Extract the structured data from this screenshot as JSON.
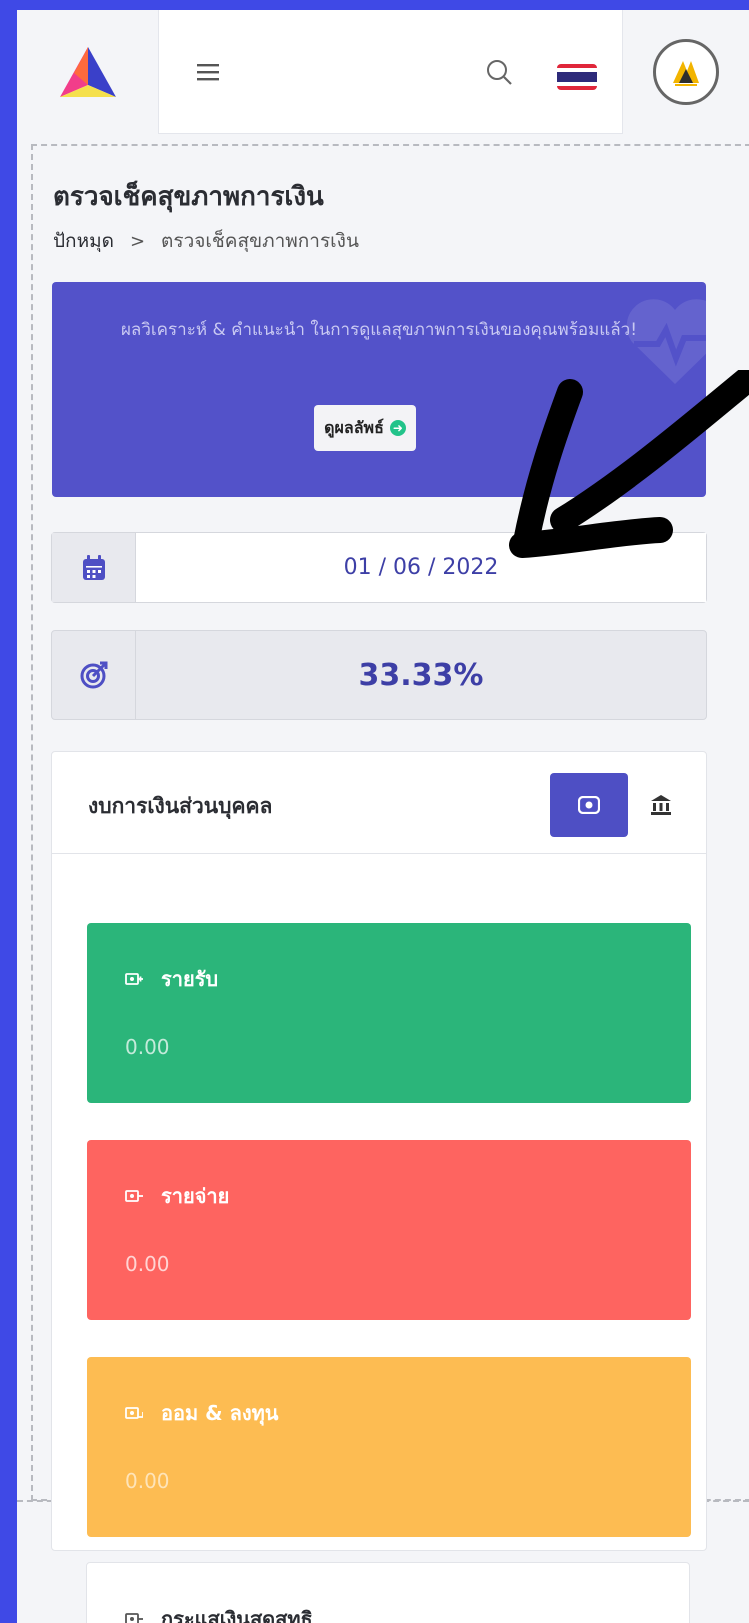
{
  "header": {
    "logo_icon": "triangle-logo-icon",
    "menu_icon": "hamburger-menu-icon",
    "search_icon": "search-icon",
    "flag_icon": "thai-flag-icon",
    "avatar_icon": "user-avatar-icon"
  },
  "page": {
    "title": "ตรวจเช็คสุขภาพการเงิน",
    "breadcrumb": {
      "home": "ปักหมุด",
      "separator": ">",
      "current": "ตรวจเช็คสุขภาพการเงิน"
    }
  },
  "banner": {
    "text": "ผลวิเคราะห์ & คำแนะนำ ในการดูแลสุขภาพการเงินของคุณพร้อมแล้ว!",
    "button_label": "ดูผลลัพธ์"
  },
  "date_field": {
    "value": "01 / 06 / 2022",
    "icon": "calendar-icon"
  },
  "progress": {
    "value": "33.33%",
    "icon": "target-icon"
  },
  "budget": {
    "title": "งบการเงินส่วนบุคคล",
    "eye_icon": "eye-icon",
    "bank_icon": "bank-icon",
    "items": [
      {
        "label": "รายรับ",
        "amount": "0.00",
        "color": "#2bb57a"
      },
      {
        "label": "รายจ่าย",
        "amount": "0.00",
        "color": "#fe6460"
      },
      {
        "label": "ออม & ลงทุน",
        "amount": "0.00",
        "color": "#fdbc52"
      }
    ],
    "cashflow_label": "กระแสเงินสดสุทธิ"
  },
  "colors": {
    "background": "#3f49e6",
    "accent": "#5352c9",
    "primary_text": "#3d3fa6"
  }
}
